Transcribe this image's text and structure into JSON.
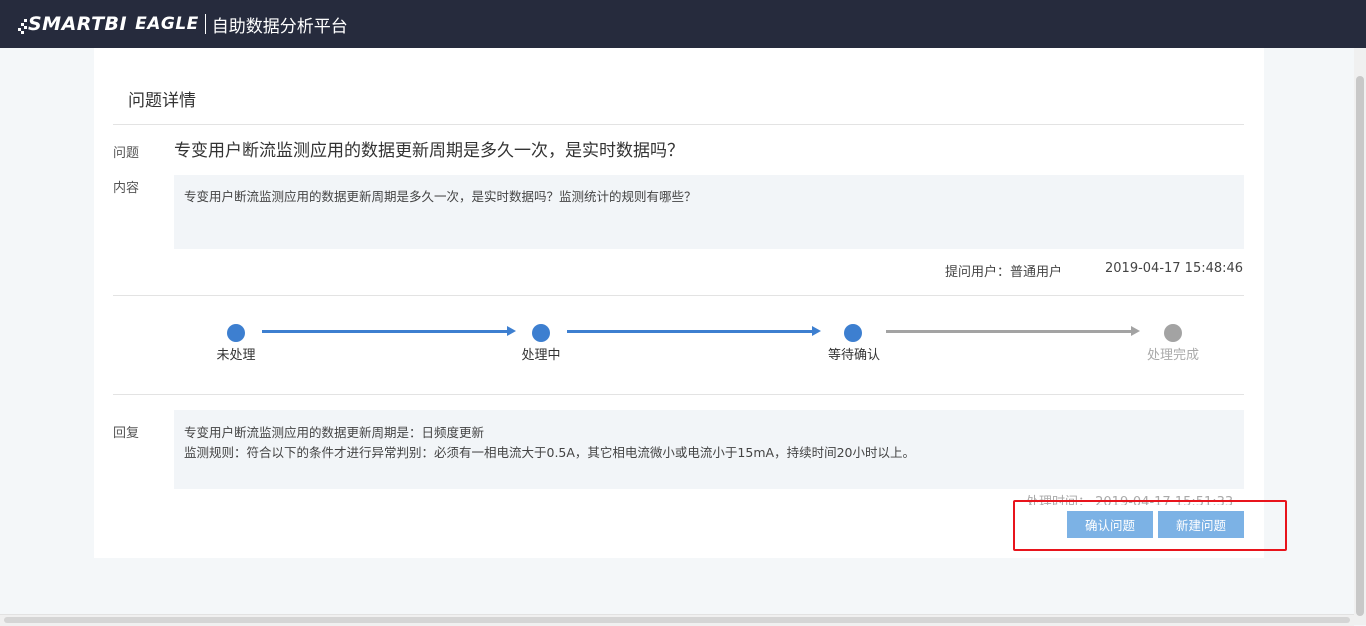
{
  "header": {
    "brand": "SMARTBI",
    "product": "EAGLE",
    "subtitle": "自助数据分析平台"
  },
  "detail": {
    "title": "问题详情",
    "question_label": "问题",
    "question": "专变用户断流监测应用的数据更新周期是多久一次，是实时数据吗？",
    "content_label": "内容",
    "content": "专变用户断流监测应用的数据更新周期是多久一次，是实时数据吗？监测统计的规则有哪些？",
    "asker": "提问用户：普通用户",
    "asked_at": "2019-04-17 15:48:46"
  },
  "progress": {
    "steps": [
      {
        "label": "未处理",
        "status": "done"
      },
      {
        "label": "处理中",
        "status": "done"
      },
      {
        "label": "等待确认",
        "status": "done"
      },
      {
        "label": "处理完成",
        "status": "pending"
      }
    ]
  },
  "reply": {
    "label": "回复",
    "line1": "专变用户断流监测应用的数据更新周期是：日频度更新",
    "line2": "监测规则：符合以下的条件才进行异常判别：必须有一相电流大于0.5A，其它相电流微小或电流小于15mA，持续时间20小时以上。",
    "handled_at": "处理时间： 2019-04-17 15:51:33"
  },
  "actions": {
    "confirm": "确认问题",
    "new": "新建问题"
  },
  "colors": {
    "header_bg": "#262b3d",
    "step_active": "#3d7fd0",
    "step_inactive": "#a3a3a3",
    "button_bg": "#7cb2e5",
    "highlight": "#e8141c"
  }
}
